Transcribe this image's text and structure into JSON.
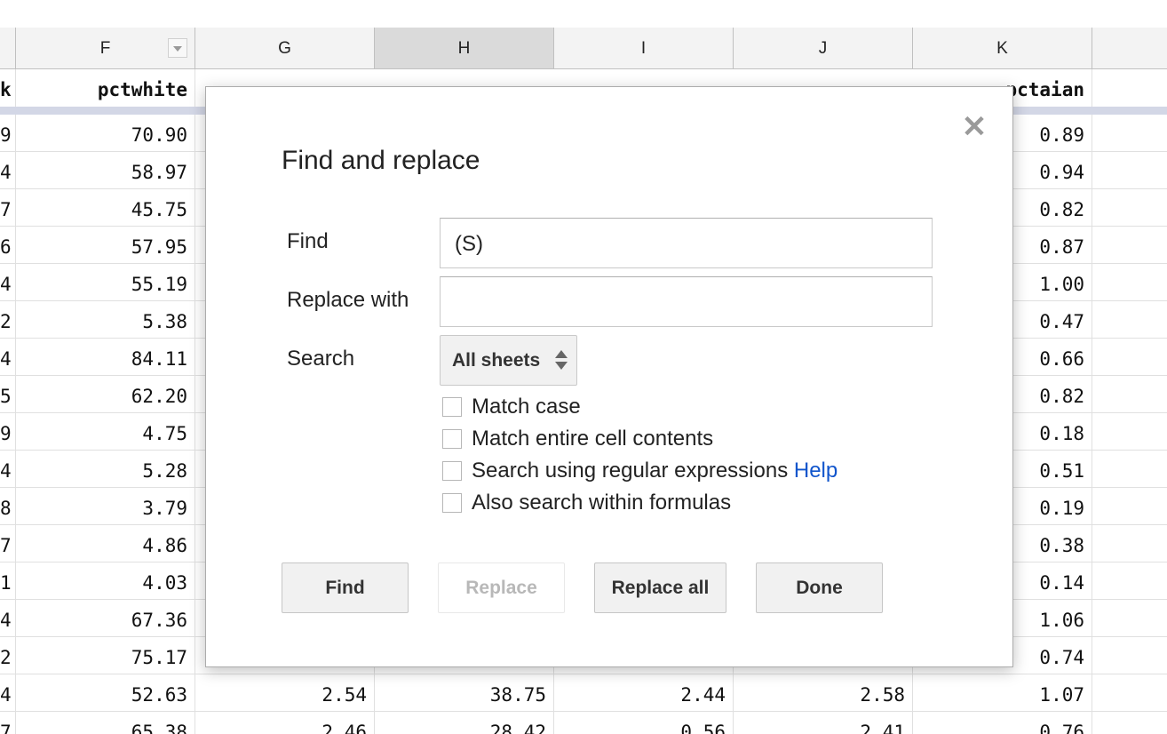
{
  "columns": {
    "F": "F",
    "G": "G",
    "H": "H",
    "I": "I",
    "J": "J",
    "K": "K"
  },
  "field_row": {
    "E": "k",
    "F": "pctwhite",
    "K": "pctaian"
  },
  "rows": [
    {
      "E": "9",
      "F": "70.90",
      "K": "0.89"
    },
    {
      "E": "4",
      "F": "58.97",
      "K": "0.94"
    },
    {
      "E": "7",
      "F": "45.75",
      "K": "0.82"
    },
    {
      "E": "6",
      "F": "57.95",
      "K": "0.87"
    },
    {
      "E": "4",
      "F": "55.19",
      "K": "1.00"
    },
    {
      "E": "2",
      "F": "5.38",
      "K": "0.47"
    },
    {
      "E": "4",
      "F": "84.11",
      "K": "0.66"
    },
    {
      "E": "5",
      "F": "62.20",
      "K": "0.82"
    },
    {
      "E": "9",
      "F": "4.75",
      "K": "0.18"
    },
    {
      "E": "4",
      "F": "5.28",
      "K": "0.51"
    },
    {
      "E": "8",
      "F": "3.79",
      "K": "0.19"
    },
    {
      "E": "7",
      "F": "4.86",
      "K": "0.38"
    },
    {
      "E": "1",
      "F": "4.03",
      "K": "0.14"
    },
    {
      "E": "4",
      "F": "67.36",
      "K": "1.06"
    },
    {
      "E": "2",
      "F": "75.17",
      "K": "0.74"
    },
    {
      "E": "4",
      "F": "52.63",
      "G": "2.54",
      "H": "38.75",
      "I": "2.44",
      "J": "2.58",
      "K": "1.07"
    },
    {
      "E": "7",
      "F": "65.38",
      "G": "2.46",
      "H": "28.42",
      "I": "0.56",
      "J": "2.41",
      "K": "0.76"
    }
  ],
  "dialog": {
    "title": "Find and replace",
    "close_glyph": "✕",
    "find_label": "Find",
    "find_value": "(S)",
    "replace_label": "Replace with",
    "replace_value": "",
    "search_label": "Search",
    "search_value": "All sheets",
    "checkboxes": {
      "match_case": "Match case",
      "match_entire": "Match entire cell contents",
      "regex": "Search using regular expressions",
      "regex_help": "Help",
      "formulas": "Also search within formulas"
    },
    "buttons": {
      "find": "Find",
      "replace": "Replace",
      "replace_all": "Replace all",
      "done": "Done"
    }
  },
  "colors": {
    "link": "#1155cc",
    "frozen_bar": "#d3d7e6",
    "selected_header": "#dadada"
  }
}
